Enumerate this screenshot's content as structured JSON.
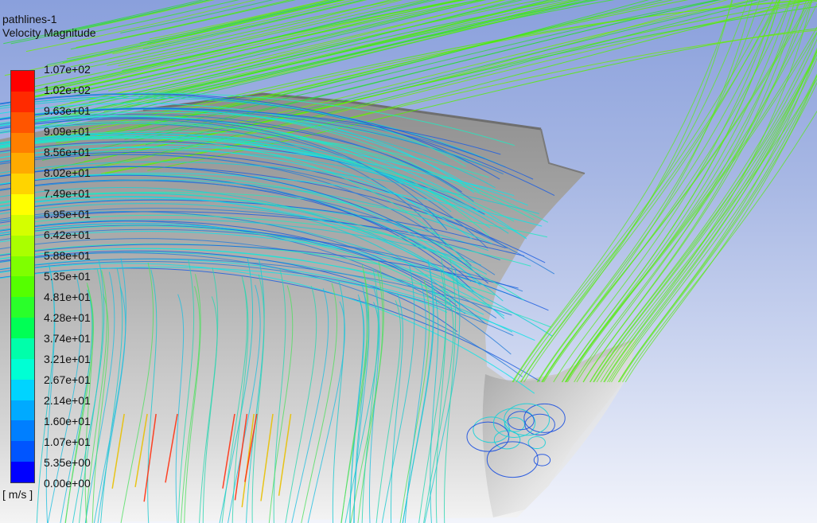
{
  "title": {
    "object_name": "pathlines-1",
    "field_name": "Velocity Magnitude"
  },
  "colorbar": {
    "units": "[ m/s ]",
    "tick_labels": [
      "1.07e+02",
      "1.02e+02",
      "9.63e+01",
      "9.09e+01",
      "8.56e+01",
      "8.02e+01",
      "7.49e+01",
      "6.95e+01",
      "6.42e+01",
      "5.88e+01",
      "5.35e+01",
      "4.81e+01",
      "4.28e+01",
      "3.74e+01",
      "3.21e+01",
      "2.67e+01",
      "2.14e+01",
      "1.60e+01",
      "1.07e+01",
      "5.35e+00",
      "0.00e+00"
    ],
    "colors_top_to_bottom": [
      "#ff0000",
      "#ff2a00",
      "#ff5500",
      "#ff7f00",
      "#ffaa00",
      "#ffd400",
      "#ffff00",
      "#d4ff00",
      "#aaff00",
      "#7fff00",
      "#55ff00",
      "#2aff2a",
      "#00ff55",
      "#00ffaa",
      "#00ffd4",
      "#00d4ff",
      "#00aaff",
      "#007fff",
      "#0055ff",
      "#0000ff"
    ]
  }
}
